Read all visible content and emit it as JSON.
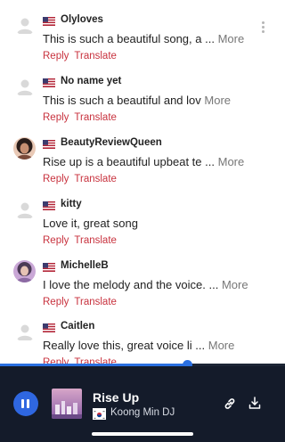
{
  "comments": [
    {
      "username": "Olyloves",
      "text": "This is such a beautiful song, a",
      "ellipsis": "...",
      "more": "More",
      "reply": "Reply",
      "translate": "Translate",
      "avatar": "default-avatar"
    },
    {
      "username": "No name yet",
      "text": "This is such a beautiful and lov",
      "ellipsis": "",
      "more": "More",
      "reply": "Reply",
      "translate": "Translate",
      "avatar": "default-avatar"
    },
    {
      "username": "BeautyReviewQueen",
      "text": "Rise up is a beautiful upbeat te",
      "ellipsis": "...",
      "more": "More",
      "reply": "Reply",
      "translate": "Translate",
      "avatar": "photo-avatar"
    },
    {
      "username": "kitty",
      "text": "Love it, great song",
      "ellipsis": "",
      "more": "",
      "reply": "Reply",
      "translate": "Translate",
      "avatar": "default-avatar"
    },
    {
      "username": "MichelleB",
      "text": "I love the melody and the voice.",
      "ellipsis": "...",
      "more": "More",
      "reply": "Reply",
      "translate": "Translate",
      "avatar": "photo-avatar"
    },
    {
      "username": "Caitlen",
      "text": "Really love this, great voice li",
      "ellipsis": "...",
      "more": "More",
      "reply": "Reply",
      "translate": "Translate",
      "avatar": "default-avatar"
    }
  ],
  "player": {
    "track_title": "Rise Up",
    "artist": "Koong Min DJ",
    "progress": 0.655,
    "accent": "#2f67e0",
    "background": "#141b2a"
  },
  "colors": {
    "action": "#c8323e",
    "more": "#777777"
  }
}
